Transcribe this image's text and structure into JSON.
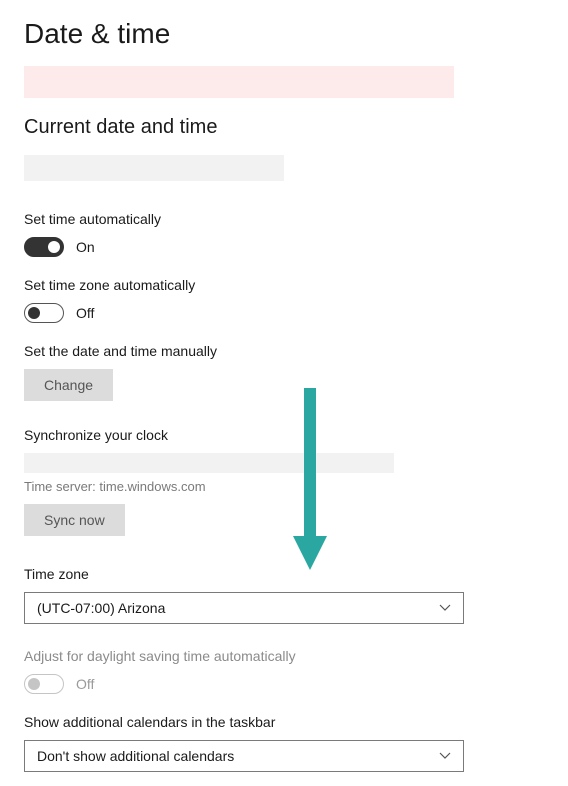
{
  "title": "Date & time",
  "subheader": "Current date and time",
  "autoTime": {
    "label": "Set time automatically",
    "state": "On"
  },
  "autoZone": {
    "label": "Set time zone automatically",
    "state": "Off"
  },
  "manual": {
    "label": "Set the date and time manually",
    "button": "Change"
  },
  "sync": {
    "label": "Synchronize your clock",
    "server": "Time server: time.windows.com",
    "button": "Sync now"
  },
  "timezone": {
    "label": "Time zone",
    "selected": "(UTC-07:00) Arizona"
  },
  "dst": {
    "label": "Adjust for daylight saving time automatically",
    "state": "Off"
  },
  "calendars": {
    "label": "Show additional calendars in the taskbar",
    "selected": "Don't show additional calendars"
  }
}
